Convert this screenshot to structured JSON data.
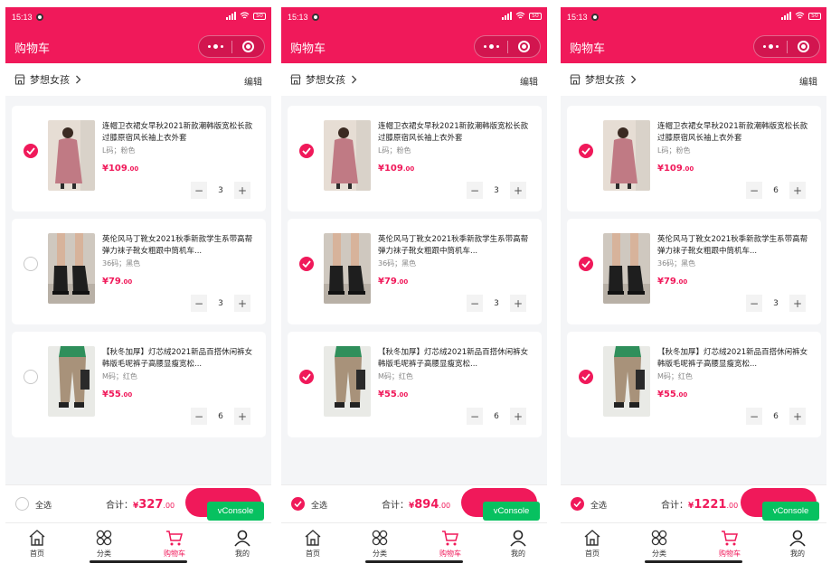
{
  "theme": {
    "accent": "#f0195a",
    "vconsole": "#07c160"
  },
  "screens": [
    {
      "status_time": "15:13",
      "battery": "50",
      "header_title": "购物车",
      "shop_name": "梦想女孩",
      "edit_label": "编辑",
      "items": [
        {
          "title": "连帽卫衣裙女早秋2021新款潮韩版宽松长款过膝原宿风长袖上衣外套",
          "spec": "L码；粉色",
          "currency": "¥",
          "price_int": "109",
          "price_dec": ".00",
          "qty": "3",
          "checked": true,
          "image": "pink-hoodie-dress"
        },
        {
          "title": "英伦风马丁靴女2021秋季新款学生系带高帮弹力袜子靴女粗跟中筒机车...",
          "spec": "36码；黑色",
          "currency": "¥",
          "price_int": "79",
          "price_dec": ".00",
          "qty": "3",
          "checked": false,
          "image": "black-martin-boots"
        },
        {
          "title": "【秋冬加厚】灯芯绒2021新品百搭休闲裤女韩版毛呢裤子高腰显瘦宽松...",
          "spec": "M码；红色",
          "currency": "¥",
          "price_int": "55",
          "price_dec": ".00",
          "qty": "6",
          "checked": false,
          "image": "khaki-corduroy-pants"
        }
      ],
      "select_all": {
        "label": "全选",
        "checked": false
      },
      "total_label": "合计：",
      "total_prefix": "¥",
      "total_int": "327",
      "total_dec": ".00",
      "vconsole_label": "vConsole",
      "tabs": [
        {
          "label": "首页",
          "icon": "home-icon",
          "active": false
        },
        {
          "label": "分类",
          "icon": "category-icon",
          "active": false
        },
        {
          "label": "购物车",
          "icon": "cart-icon",
          "active": true
        },
        {
          "label": "我的",
          "icon": "user-icon",
          "active": false
        }
      ]
    },
    {
      "status_time": "15:13",
      "battery": "50",
      "header_title": "购物车",
      "shop_name": "梦想女孩",
      "edit_label": "编辑",
      "items": [
        {
          "title": "连帽卫衣裙女早秋2021新款潮韩版宽松长款过膝原宿风长袖上衣外套",
          "spec": "L码；粉色",
          "currency": "¥",
          "price_int": "109",
          "price_dec": ".00",
          "qty": "3",
          "checked": true,
          "image": "pink-hoodie-dress"
        },
        {
          "title": "英伦风马丁靴女2021秋季新款学生系带高帮弹力袜子靴女粗跟中筒机车...",
          "spec": "36码；黑色",
          "currency": "¥",
          "price_int": "79",
          "price_dec": ".00",
          "qty": "3",
          "checked": true,
          "image": "black-martin-boots"
        },
        {
          "title": "【秋冬加厚】灯芯绒2021新品百搭休闲裤女韩版毛呢裤子高腰显瘦宽松...",
          "spec": "M码；红色",
          "currency": "¥",
          "price_int": "55",
          "price_dec": ".00",
          "qty": "6",
          "checked": true,
          "image": "khaki-corduroy-pants"
        }
      ],
      "select_all": {
        "label": "全选",
        "checked": true
      },
      "total_label": "合计：",
      "total_prefix": "¥",
      "total_int": "894",
      "total_dec": ".00",
      "vconsole_label": "vConsole",
      "tabs": [
        {
          "label": "首页",
          "icon": "home-icon",
          "active": false
        },
        {
          "label": "分类",
          "icon": "category-icon",
          "active": false
        },
        {
          "label": "购物车",
          "icon": "cart-icon",
          "active": true
        },
        {
          "label": "我的",
          "icon": "user-icon",
          "active": false
        }
      ]
    },
    {
      "status_time": "15:13",
      "battery": "50",
      "header_title": "购物车",
      "shop_name": "梦想女孩",
      "edit_label": "编辑",
      "items": [
        {
          "title": "连帽卫衣裙女早秋2021新款潮韩版宽松长款过膝原宿风长袖上衣外套",
          "spec": "L码；粉色",
          "currency": "¥",
          "price_int": "109",
          "price_dec": ".00",
          "qty": "6",
          "checked": true,
          "image": "pink-hoodie-dress"
        },
        {
          "title": "英伦风马丁靴女2021秋季新款学生系带高帮弹力袜子靴女粗跟中筒机车...",
          "spec": "36码；黑色",
          "currency": "¥",
          "price_int": "79",
          "price_dec": ".00",
          "qty": "3",
          "checked": true,
          "image": "black-martin-boots"
        },
        {
          "title": "【秋冬加厚】灯芯绒2021新品百搭休闲裤女韩版毛呢裤子高腰显瘦宽松...",
          "spec": "M码；红色",
          "currency": "¥",
          "price_int": "55",
          "price_dec": ".00",
          "qty": "6",
          "checked": true,
          "image": "khaki-corduroy-pants"
        }
      ],
      "select_all": {
        "label": "全选",
        "checked": true
      },
      "total_label": "合计：",
      "total_prefix": "¥",
      "total_int": "1221",
      "total_dec": ".00",
      "vconsole_label": "vConsole",
      "tabs": [
        {
          "label": "首页",
          "icon": "home-icon",
          "active": false
        },
        {
          "label": "分类",
          "icon": "category-icon",
          "active": false
        },
        {
          "label": "购物车",
          "icon": "cart-icon",
          "active": true
        },
        {
          "label": "我的",
          "icon": "user-icon",
          "active": false
        }
      ]
    }
  ]
}
